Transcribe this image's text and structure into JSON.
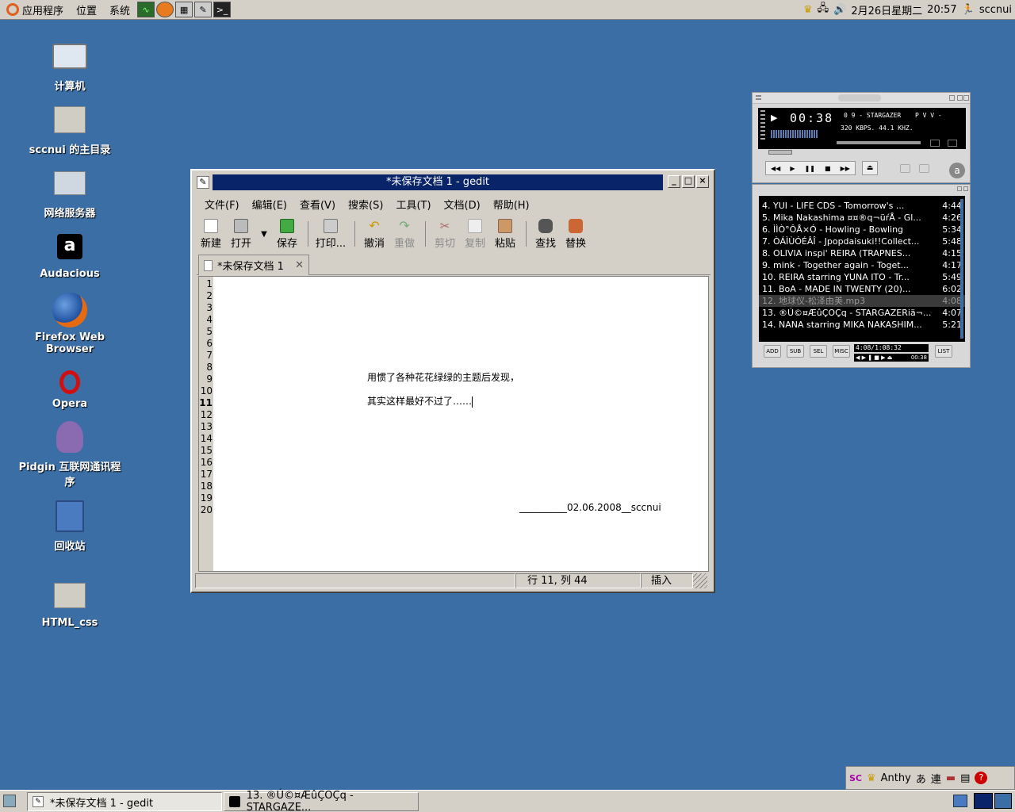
{
  "top_panel": {
    "menus": [
      "应用程序",
      "位置",
      "系统"
    ],
    "date": "2月26日星期二",
    "time": "20:57",
    "user": "sccnui"
  },
  "desktop": {
    "icons": [
      "计算机",
      "sccnui 的主目录",
      "网络服务器",
      "Audacious",
      "Firefox Web Browser",
      "Opera",
      "Pidgin 互联网通讯程序",
      "回收站",
      "HTML_css"
    ]
  },
  "gedit": {
    "title": "*未保存文档 1 - gedit",
    "menu": [
      "文件(F)",
      "编辑(E)",
      "查看(V)",
      "搜索(S)",
      "工具(T)",
      "文档(D)",
      "帮助(H)"
    ],
    "toolbar": {
      "new": "新建",
      "open": "打开",
      "save": "保存",
      "print": "打印...",
      "undo": "撤消",
      "redo": "重做",
      "cut": "剪切",
      "copy": "复制",
      "paste": "粘贴",
      "find": "查找",
      "replace": "替换"
    },
    "tab_label": "*未保存文档 1",
    "lines": [
      "1",
      "2",
      "3",
      "4",
      "5",
      "6",
      "7",
      "8",
      "9",
      "10",
      "11",
      "12",
      "13",
      "14",
      "15",
      "16",
      "17",
      "18",
      "19",
      "20"
    ],
    "text": {
      "line9": "用惯了各种花花绿绿的主题后发现，",
      "line11": "其实这样最好不过了……",
      "line20": "__________02.06.2008__sccnui"
    },
    "status": {
      "position": "行 11, 列 44",
      "mode": "插入"
    }
  },
  "audacious": {
    "time": "00:38",
    "track": "0 9 - STARGAZER",
    "pv": "P V V -",
    "kbps": "320 KBPS. 44.1 KHZ.",
    "playlist": [
      {
        "t": "4. YUI - LIFE CDS - Tomorrow's ...",
        "d": "4:44"
      },
      {
        "t": "5. Mika Nakashima ¤¤®q¬üŕÅ - Gl...",
        "d": "4:26"
      },
      {
        "t": "6. ÌÌÒ°ÔÅ×Ó - Howling - Bowling",
        "d": "5:34"
      },
      {
        "t": "7. ÒÁÌÙÓÉÂÎ - Jpopdaisuki!!Collect...",
        "d": "5:48"
      },
      {
        "t": "8. OLIVIA inspi' REIRA (TRAPNES...",
        "d": "4:15"
      },
      {
        "t": "9. mink - Together again - Toget...",
        "d": "4:17"
      },
      {
        "t": "10. REIRA starring YUNA ITO - Tr...",
        "d": "5:49"
      },
      {
        "t": "11. BoA - MADE IN TWENTY (20)...",
        "d": "6:02"
      },
      {
        "t": "12. 地球仪-松泽由美.mp3",
        "d": "4:08"
      },
      {
        "t": "13. ®Ú©¤ÆûÇOÇq - STARGAZERiä¬...",
        "d": "4:07"
      },
      {
        "t": "14. NANA starring MIKA NAKASHIM...",
        "d": "5:21"
      }
    ],
    "buttons": [
      "ADD",
      "SUB",
      "SEL",
      "MISC",
      "LIST"
    ],
    "total": "4:08/1:08:32",
    "small_time": "00:38"
  },
  "taskbar": {
    "task1": "*未保存文档 1 - gedit",
    "task2": "13. ®Ú©¤ÆûÇOÇq - STARGAZE..."
  },
  "im_bar": {
    "name": "Anthy",
    "mode": "あ",
    "conv": "連"
  }
}
